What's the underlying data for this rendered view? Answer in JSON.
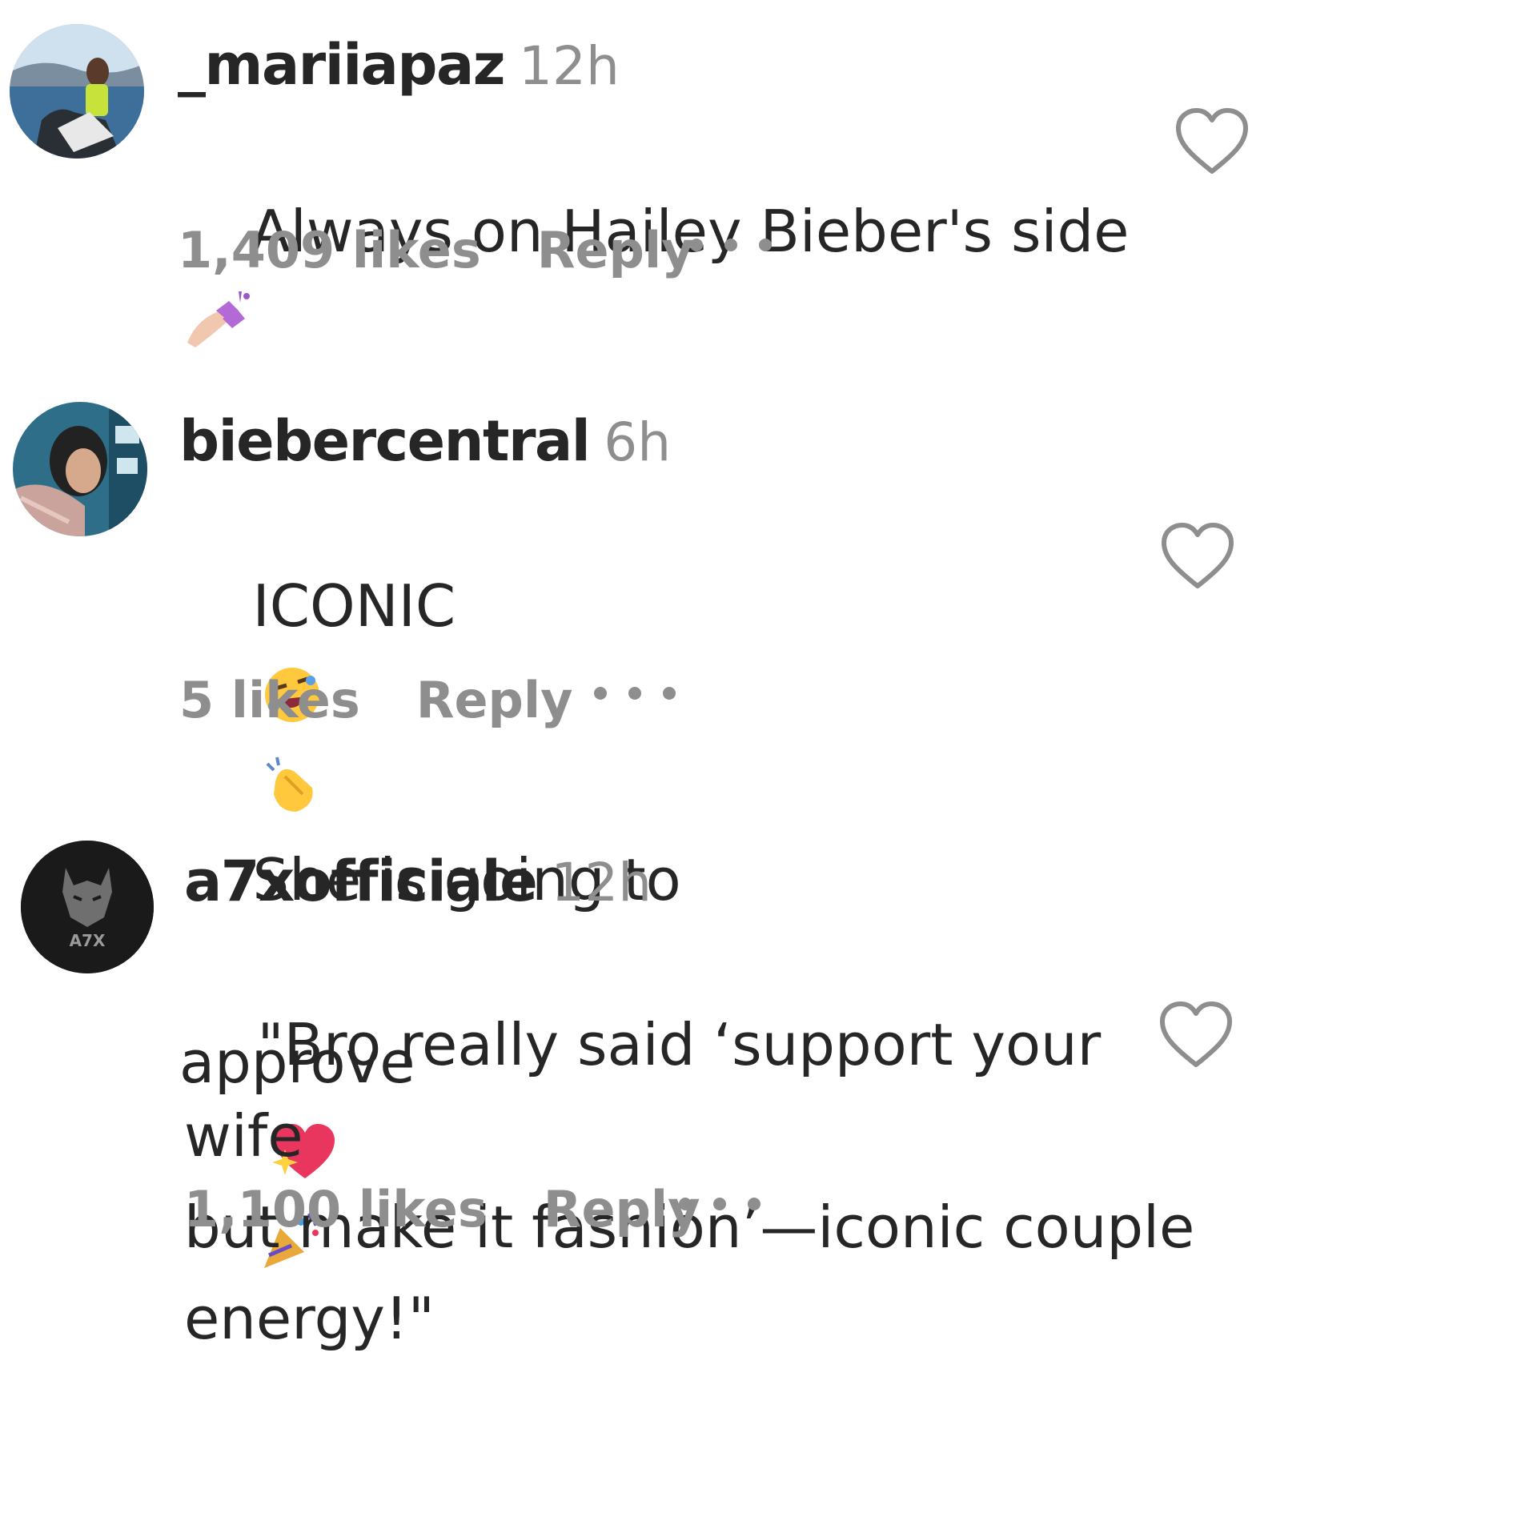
{
  "comments": [
    {
      "username": "_mariiapaz",
      "time": "12h",
      "text_before": "Always on Hailey Bieber's side",
      "emoji_1": "nail-polish-emoji",
      "likes": "1,409 likes",
      "reply": "Reply",
      "avatar": "beach-photo-avatar"
    },
    {
      "username": "biebercentral",
      "time": "6h",
      "line1_a": "ICONIC",
      "emoji_a": "rolling-laughing-emoji",
      "emoji_b": "clapping-hands-emoji",
      "line1_b": "She is going to",
      "line2": "approve",
      "emoji_c": "sparkling-heart-emoji",
      "emoji_d": "party-popper-emoji",
      "likes": "5 likes",
      "reply": "Reply",
      "avatar": "bieber-central-avatar"
    },
    {
      "username": "a7xofficiale",
      "time": "12h",
      "line1": "\"Bro really said ‘support your wife",
      "line2": "but make it fashion’—iconic couple",
      "line3": "energy!\"",
      "likes": "1,100 likes",
      "reply": "Reply",
      "avatar_text": "A7X"
    }
  ],
  "colors": {
    "text": "#262626",
    "secondary": "#8e8e8e",
    "heart_outline": "#8e8e8e"
  }
}
